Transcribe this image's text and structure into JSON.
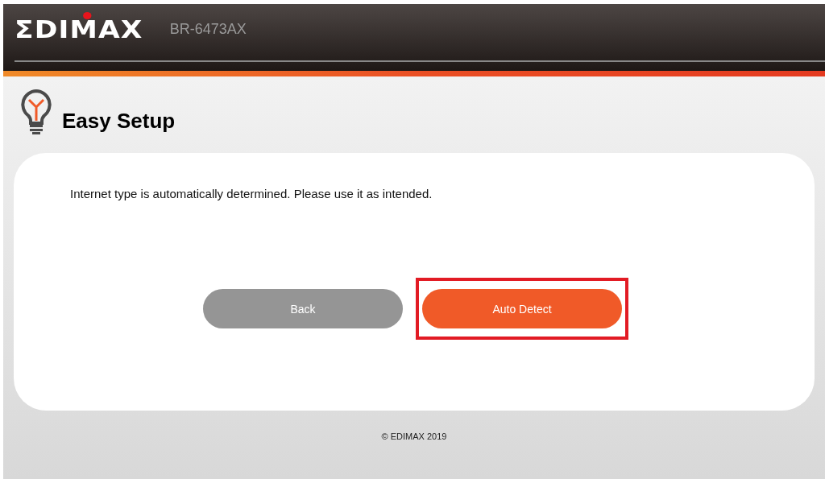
{
  "header": {
    "logo": "ΣDIMAX",
    "model": "BR-6473AX"
  },
  "page": {
    "title": "Easy Setup"
  },
  "card": {
    "message": "Internet type is automatically determined. Please use it as intended.",
    "buttons": [
      {
        "label": "Back",
        "kind": "secondary",
        "highlighted": false
      },
      {
        "label": "Auto Detect",
        "kind": "primary",
        "highlighted": true
      }
    ]
  },
  "footer": {
    "copyright": "© EDIMAX 2019"
  }
}
